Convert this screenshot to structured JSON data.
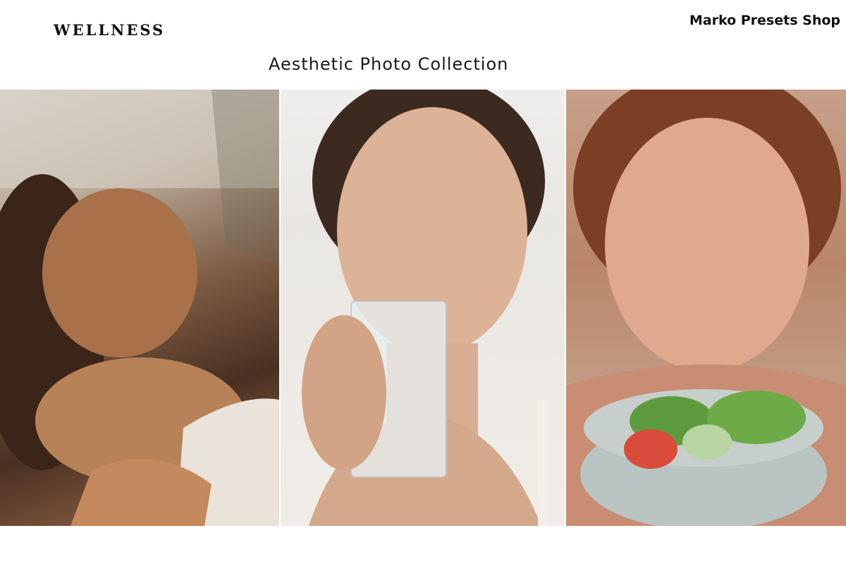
{
  "header": {
    "brand": "WELLNESS",
    "shop_name": "Marko Presets Shop",
    "subtitle": "Aesthetic Photo Collection"
  },
  "photos": [
    {
      "subject": "woman-relaxing-spa-sunlight"
    },
    {
      "subject": "woman-drinking-water-glass"
    },
    {
      "subject": "woman-holding-salad-bowl"
    }
  ]
}
